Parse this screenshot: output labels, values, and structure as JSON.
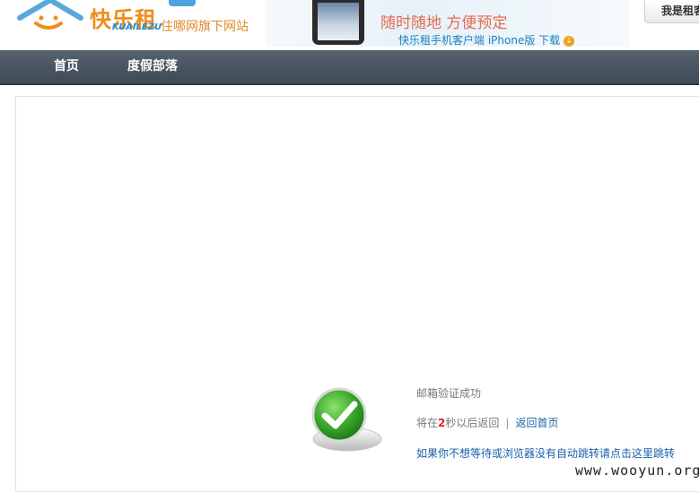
{
  "header": {
    "logo_text": "快乐租",
    "logo_en": "KUAILEZU",
    "tagline": "住哪网旗下网站",
    "banner_title": "随时随地 方便预定",
    "banner_sub": "快乐租手机客户端 iPhone版 下载",
    "landlord_button": "我是租客"
  },
  "nav": {
    "items": [
      {
        "label": "首页"
      },
      {
        "label": "度假部落"
      }
    ]
  },
  "message": {
    "status": "邮箱验证成功",
    "redirect_prefix": "将在",
    "countdown": "2",
    "redirect_suffix": "秒以后返回",
    "separator": "|",
    "home_link": "返回首页",
    "manual_jump": "如果你不想等待或浏览器没有自动跳转请点击这里跳转"
  },
  "watermark": "www.wooyun.org",
  "colors": {
    "accent_orange": "#f08c1a",
    "nav_bg": "#4a5560",
    "link_blue": "#1a5fa8",
    "success_green": "#3aa82a"
  }
}
